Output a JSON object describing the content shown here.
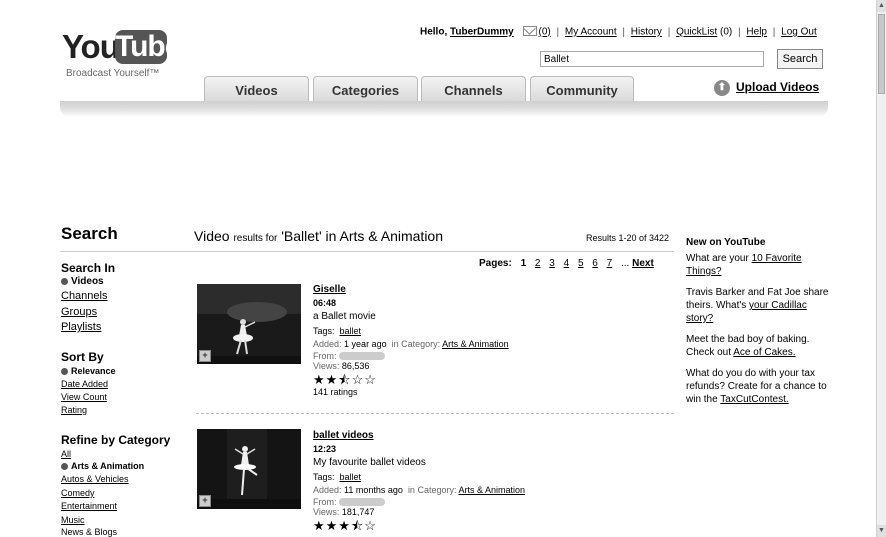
{
  "header": {
    "logo": {
      "you": "You",
      "tube": "Tube",
      "tagline": "Broadcast Yourself™"
    },
    "greeting": "Hello,",
    "username": "TuberDummy",
    "inbox_count": "(0)",
    "links": [
      "My Account",
      "History"
    ],
    "quicklist_label": "QuickList",
    "quicklist_count": "(0)",
    "links2": [
      "Help",
      "Log Out"
    ],
    "search_value": "Ballet",
    "search_button": "Search"
  },
  "nav": {
    "tabs": [
      "Videos",
      "Categories",
      "Channels",
      "Community"
    ],
    "upload_label": "Upload Videos"
  },
  "search": {
    "heading": "Search",
    "results_prefix": "Video",
    "results_small": "results for",
    "results_query": "'Ballet' in Arts & Animation",
    "results_count": "Results 1-20 of 3422",
    "pages_label": "Pages:",
    "pages": [
      "1",
      "2",
      "3",
      "4",
      "5",
      "6",
      "7"
    ],
    "ellipsis": "...",
    "next": "Next"
  },
  "sidebar": {
    "search_in": {
      "heading": "Search In",
      "selected": "Videos",
      "items": [
        "Channels",
        "Groups",
        "Playlists"
      ]
    },
    "sort_by": {
      "heading": "Sort By",
      "selected": "Relevance",
      "items": [
        "Date Added",
        "View Count",
        "Rating"
      ]
    },
    "refine": {
      "heading": "Refine by Category",
      "all": "All",
      "selected": "Arts & Animation",
      "items": [
        "Autos & Vehicles",
        "Comedy",
        "Entertainment",
        "Music",
        "News & Blogs"
      ]
    }
  },
  "videos": [
    {
      "title": "Giselle",
      "duration": "06:48",
      "description": "a Ballet movie",
      "tags_label": "Tags:",
      "tag": "ballet",
      "added_label": "Added:",
      "added": "1 year ago",
      "category_label": "in Category:",
      "category": "Arts & Animation",
      "from_label": "From:",
      "views_label": "Views:",
      "views": "86,536",
      "rating": 2.5,
      "stars": "★★⯪☆☆",
      "ratings": "141 ratings"
    },
    {
      "title": "ballet videos",
      "duration": "12:23",
      "description": "My favourite ballet videos",
      "tags_label": "Tags:",
      "tag": "ballet",
      "added_label": "Added:",
      "added": "11 months ago",
      "category_label": "in Category:",
      "category": "Arts & Animation",
      "from_label": "From:",
      "views_label": "Views:",
      "views": "181,747",
      "rating": 3.5,
      "stars": "★★★⯪☆"
    }
  ],
  "right_col": {
    "heading": "New on YouTube",
    "p1_text": "What are your",
    "p1_link": "10 Favorite Things?",
    "p2_text": "Travis Barker and Fat Joe share theirs. What's",
    "p2_link": "your Cadillac story?",
    "p3_text": "Meet the bad boy of baking. Check out",
    "p3_link": "Ace of Cakes.",
    "p4_text": "What do you do with your tax refunds? Create for a chance to win the",
    "p4_link": "TaxCutContest."
  }
}
